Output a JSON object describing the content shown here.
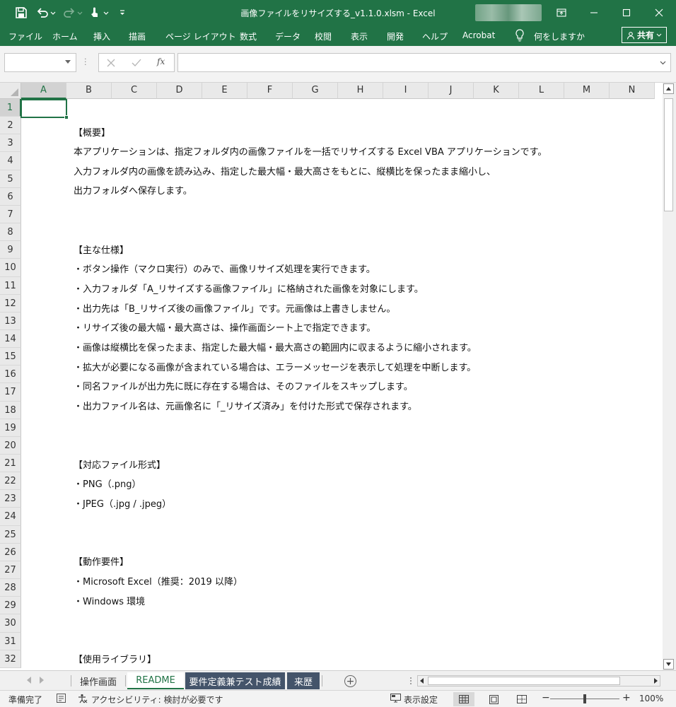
{
  "window": {
    "title": "画像ファイルをリサイズする_v1.1.0.xlsm  -  Excel"
  },
  "qat": {
    "save_icon": "save-icon",
    "undo_icon": "undo-icon",
    "redo_icon": "redo-icon",
    "touch_icon": "touch-mode-icon",
    "customize_icon": "customize-qat-icon"
  },
  "ribbon": {
    "tabs": [
      "ファイル",
      "ホーム",
      "挿入",
      "描画",
      "ページ レイアウト",
      "数式",
      "データ",
      "校閲",
      "表示",
      "開発",
      "ヘルプ",
      "Acrobat"
    ],
    "tell_me": "何をしますか",
    "share": "共有"
  },
  "formula_bar": {
    "name_box": "",
    "formula": "",
    "fx": "fx"
  },
  "grid": {
    "columns": [
      "A",
      "B",
      "C",
      "D",
      "E",
      "F",
      "G",
      "H",
      "I",
      "J",
      "K",
      "L",
      "M",
      "N"
    ],
    "rows": [
      "1",
      "2",
      "3",
      "4",
      "5",
      "6",
      "7",
      "8",
      "9",
      "10",
      "11",
      "12",
      "13",
      "14",
      "15",
      "16",
      "17",
      "18",
      "19",
      "20",
      "21",
      "22",
      "23",
      "24",
      "25",
      "26",
      "27",
      "28",
      "29",
      "30",
      "31",
      "32"
    ],
    "selected_cell": "A1"
  },
  "content": {
    "overview_heading": "【概要】",
    "overview_1": "本アプリケーションは、指定フォルダ内の画像ファイルを一括でリサイズする Excel VBA アプリケーションです。",
    "overview_2": "入力フォルダ内の画像を読み込み、指定した最大幅・最大高さをもとに、縦横比を保ったまま縮小し、",
    "overview_3": "出力フォルダへ保存します。",
    "spec_heading": "【主な仕様】",
    "spec_1": "・ボタン操作（マクロ実行）のみで、画像リサイズ処理を実行できます。",
    "spec_2": "・入力フォルダ「A_リサイズする画像ファイル」に格納された画像を対象にします。",
    "spec_3": "・出力先は「B_リサイズ後の画像ファイル」です。元画像は上書きしません。",
    "spec_4": "・リサイズ後の最大幅・最大高さは、操作画面シート上で指定できます。",
    "spec_5": "・画像は縦横比を保ったまま、指定した最大幅・最大高さの範囲内に収まるように縮小されます。",
    "spec_6": "・拡大が必要になる画像が含まれている場合は、エラーメッセージを表示して処理を中断します。",
    "spec_7": "・同名ファイルが出力先に既に存在する場合は、そのファイルをスキップします。",
    "spec_8": "・出力ファイル名は、元画像名に「_リサイズ済み」を付けた形式で保存されます。",
    "formats_heading": "【対応ファイル形式】",
    "format_1": "・PNG（.png）",
    "format_2": "・JPEG（.jpg / .jpeg）",
    "req_heading": "【動作要件】",
    "req_1": "・Microsoft Excel（推奨：2019 以降）",
    "req_2": "・Windows 環境",
    "lib_heading": "【使用ライブラリ】"
  },
  "sheets": {
    "tabs": [
      "操作画面",
      "README",
      "要件定義兼テスト成績",
      "来歴"
    ],
    "active": "README"
  },
  "status": {
    "ready": "準備完了",
    "accessibility": "アクセシビリティ: 検討が必要です",
    "display_settings": "表示設定",
    "zoom": "100%"
  },
  "colors": {
    "accent": "#217346",
    "sheet_tab_dark": "#44546a"
  }
}
